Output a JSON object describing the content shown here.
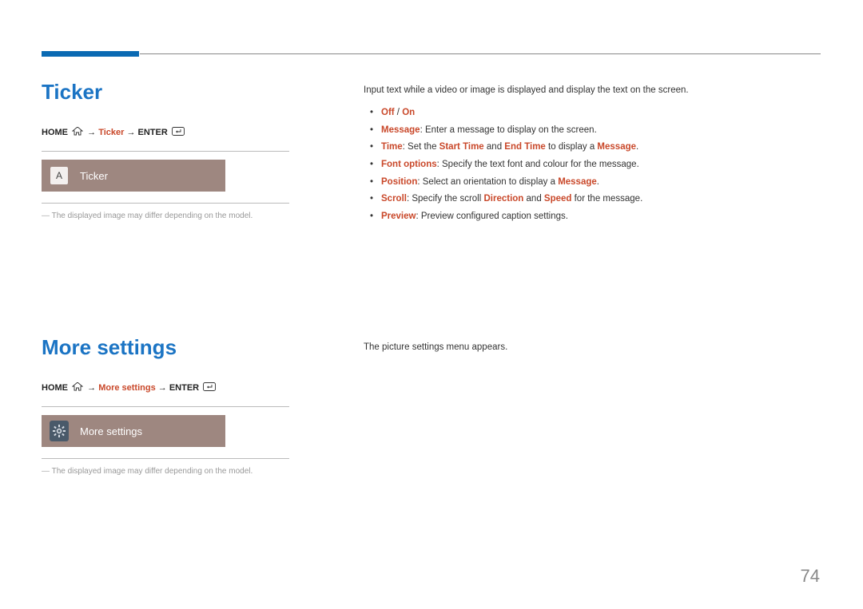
{
  "page_number": "74",
  "section1": {
    "title": "Ticker",
    "nav_home": "HOME",
    "nav_item": "Ticker",
    "nav_enter": "ENTER",
    "arrow": "→",
    "menu_label": "Ticker",
    "menu_icon_text": "A",
    "note": "The displayed image may differ depending on the model.",
    "intro": "Input text while a video or image is displayed and display the text on the screen.",
    "b1_off": "Off",
    "b1_sep": " / ",
    "b1_on": "On",
    "b2_k": "Message",
    "b2_v": ": Enter a message to display on the screen.",
    "b3_k": "Time",
    "b3_p1": ": Set the ",
    "b3_s1": "Start Time",
    "b3_p2": " and ",
    "b3_s2": "End Time",
    "b3_p3": " to display a ",
    "b3_s3": "Message",
    "b3_p4": ".",
    "b4_k": "Font options",
    "b4_v": ": Specify the text font and colour for the message.",
    "b5_k": "Position",
    "b5_p1": ": Select an orientation to display a ",
    "b5_s1": "Message",
    "b5_p2": ".",
    "b6_k": "Scroll",
    "b6_p1": ": Specify the scroll ",
    "b6_s1": "Direction",
    "b6_p2": " and ",
    "b6_s2": "Speed",
    "b6_p3": " for the message.",
    "b7_k": "Preview",
    "b7_v": ": Preview configured caption settings."
  },
  "section2": {
    "title": "More settings",
    "nav_home": "HOME",
    "nav_item": "More settings",
    "nav_enter": "ENTER",
    "arrow": "→",
    "menu_label": "More settings",
    "note": "The displayed image may differ depending on the model.",
    "body": "The picture settings menu appears."
  }
}
